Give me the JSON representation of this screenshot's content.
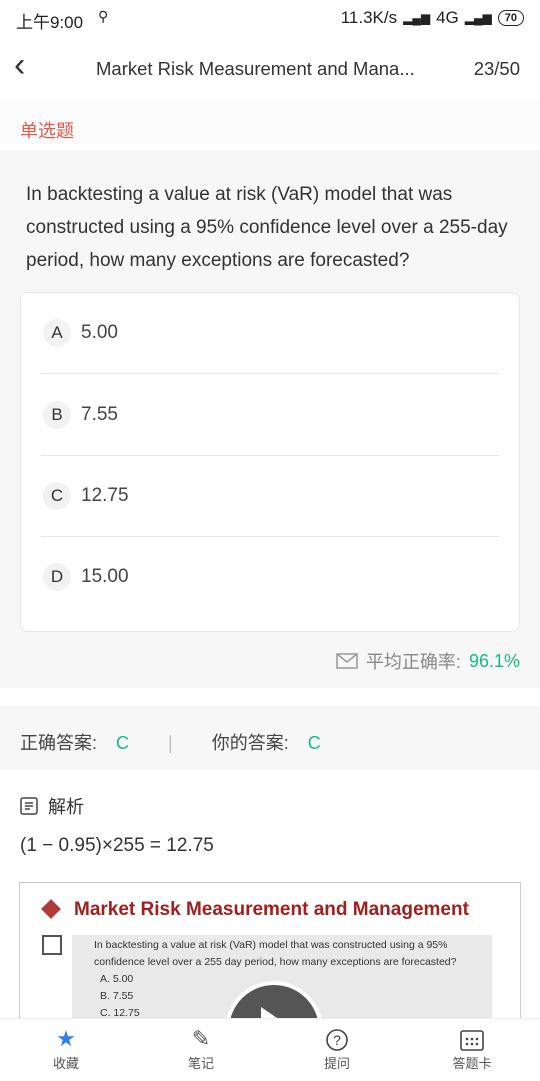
{
  "status_bar": {
    "time": "上午9:00",
    "network": "11.3K/s",
    "signal": "4G",
    "battery": "70"
  },
  "nav": {
    "title": "Market Risk Measurement  and Mana...",
    "counter": "23/50"
  },
  "question": {
    "type_label": "单选题",
    "text": "In backtesting a value at risk (VaR) model that was constructed using a 95% confidence level over a 255-day period, how many exceptions are forecasted?",
    "options": [
      {
        "letter": "A",
        "text": "5.00"
      },
      {
        "letter": "B",
        "text": "7.55"
      },
      {
        "letter": "C",
        "text": "12.75"
      },
      {
        "letter": "D",
        "text": "15.00"
      }
    ]
  },
  "stats": {
    "avg_label": "平均正确率:",
    "avg_value": "96.1%"
  },
  "answers": {
    "correct_label": "正确答案:",
    "correct_value": "C",
    "yours_label": "你的答案:",
    "yours_value": "C"
  },
  "analysis": {
    "heading": "解析",
    "formula": "(1 − 0.95)×255 = 12.75",
    "slide": {
      "title": "Market Risk Measurement and Management",
      "text": "In backtesting a value at risk (VaR) model that was constructed using a 95% confidence level over a 255 day period, how many exceptions are forecasted?",
      "options": [
        "A.  5.00",
        "B.  7.55",
        "C.  12.75"
      ]
    }
  },
  "tabbar": {
    "items": [
      {
        "label": "收藏",
        "icon": "star-icon"
      },
      {
        "label": "笔记",
        "icon": "edit-icon"
      },
      {
        "label": "提问",
        "icon": "question-icon"
      },
      {
        "label": "答题卡",
        "icon": "answer-card-icon"
      }
    ]
  },
  "colors": {
    "accent_green": "#19b98a",
    "type_red": "#e05a4b",
    "star_blue": "#2f80ed"
  }
}
